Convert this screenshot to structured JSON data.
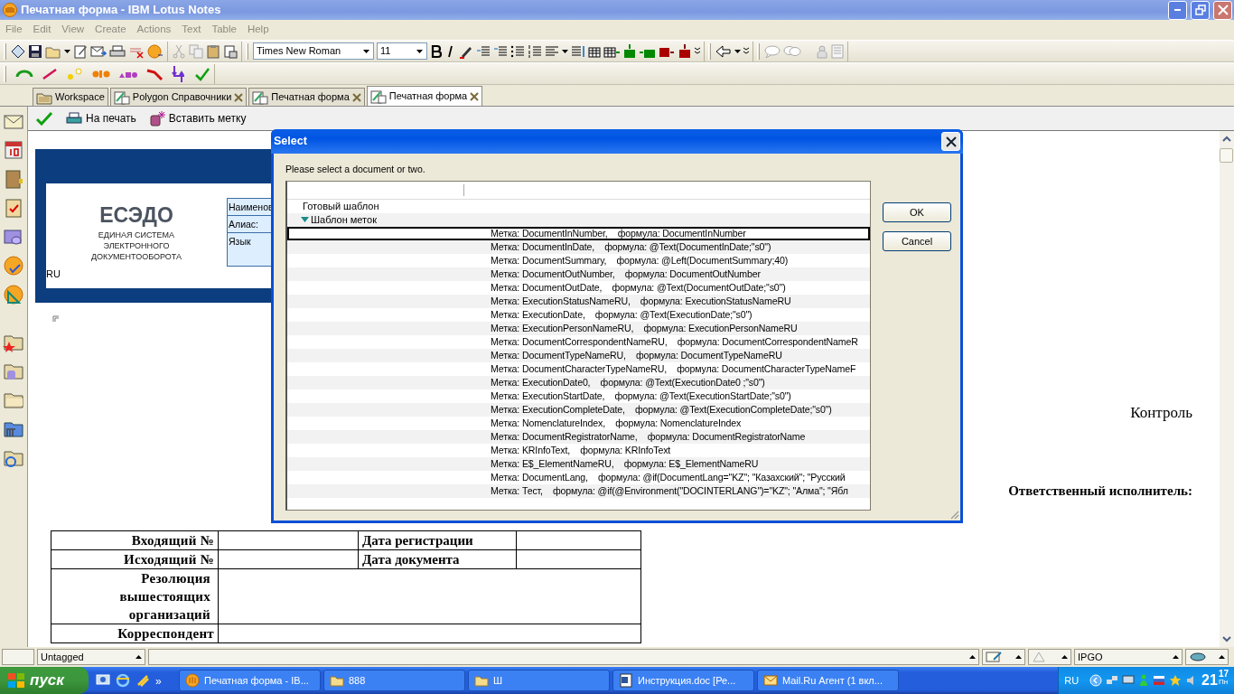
{
  "window": {
    "title": "Печатная форма - IBM Lotus Notes"
  },
  "menu": [
    {
      "label": "File",
      "disabled": true
    },
    {
      "label": "Edit",
      "disabled": true
    },
    {
      "label": "View",
      "disabled": true
    },
    {
      "label": "Create",
      "disabled": true
    },
    {
      "label": "Actions",
      "disabled": true
    },
    {
      "label": "Text",
      "disabled": true
    },
    {
      "label": "Table",
      "disabled": true
    },
    {
      "label": "Help",
      "disabled": true
    }
  ],
  "format_toolbar": {
    "font": "Times New Roman",
    "size": "11"
  },
  "tabs": [
    {
      "label": "Workspace",
      "kind": "workspace",
      "closable": false,
      "selected": false
    },
    {
      "label": "Polygon Справочники",
      "kind": "database",
      "closable": true,
      "selected": false
    },
    {
      "label": "Печатная форма",
      "kind": "database",
      "closable": true,
      "selected": false
    },
    {
      "label": "Печатная форма",
      "kind": "database",
      "closable": true,
      "selected": true
    }
  ],
  "action_bar": [
    {
      "kind": "check"
    },
    {
      "kind": "print",
      "label": "На печать"
    },
    {
      "kind": "tag",
      "label": "Вставить метку"
    }
  ],
  "document": {
    "logo": "ЕСЭДО",
    "logo_subtitle": [
      "ЕДИНАЯ СИСТЕМА",
      "ЭЛЕКТРОННОГО",
      "ДОКУМЕНТООБОРОТА"
    ],
    "language_code": "RU",
    "info_labels": [
      "Наименов",
      "Алиас:",
      "Язык"
    ],
    "right_labels": [
      {
        "label": "Контроль",
        "bold": false
      },
      {
        "label": "Ответственный исполнитель:",
        "bold": true
      }
    ],
    "table": {
      "rows": [
        {
          "label": "Входящий №",
          "field_label": "Дата регистрации"
        },
        {
          "label": "Исходящий №",
          "field_label": "Дата документа"
        },
        {
          "label": "Резолюция вышестоящих организаций"
        },
        {
          "label": "Корреспондент"
        }
      ]
    }
  },
  "dialog": {
    "title": "Select",
    "prompt": "Please select a document or two.",
    "categories": [
      {
        "label": "Готовый шаблон"
      },
      {
        "label": "Шаблон меток",
        "expanded": true,
        "children": [
          {
            "label": "Метка: DocumentInNumber,    формула: DocumentInNumber",
            "focused": true
          },
          {
            "label": "Метка: DocumentInDate,    формула: @Text(DocumentInDate;\"s0\")",
            "focused": false
          },
          {
            "label": "Метка: DocumentSummary,    формула: @Left(DocumentSummary;40)",
            "focused": false
          },
          {
            "label": "Метка: DocumentOutNumber,    формула: DocumentOutNumber",
            "focused": false
          },
          {
            "label": "Метка: DocumentOutDate,    формула: @Text(DocumentOutDate;\"s0\")",
            "focused": false
          },
          {
            "label": "Метка: ExecutionStatusNameRU,    формула: ExecutionStatusNameRU",
            "focused": false
          },
          {
            "label": "Метка: ExecutionDate,    формула: @Text(ExecutionDate;\"s0\")",
            "focused": false
          },
          {
            "label": "Метка: ExecutionPersonNameRU,    формула: ExecutionPersonNameRU",
            "focused": false
          },
          {
            "label": "Метка: DocumentCorrespondentNameRU,    формула: DocumentCorrespondentNameR",
            "focused": false
          },
          {
            "label": "Метка: DocumentTypeNameRU,    формула: DocumentTypeNameRU",
            "focused": false
          },
          {
            "label": "Метка: DocumentCharacterTypeNameRU,    формула: DocumentCharacterTypeNameF",
            "focused": false
          },
          {
            "label": "Метка: ExecutionDate0,    формула: @Text(ExecutionDate0 ;\"s0\")",
            "focused": false
          },
          {
            "label": "Метка: ExecutionStartDate,    формула: @Text(ExecutionStartDate;\"s0\")",
            "focused": false
          },
          {
            "label": "Метка: ExecutionCompleteDate,    формула: @Text(ExecutionCompleteDate;\"s0\")",
            "focused": false
          },
          {
            "label": "Метка: NomenclatureIndex,    формула: NomenclatureIndex",
            "focused": false
          },
          {
            "label": "Метка: DocumentRegistratorName,    формула: DocumentRegistratorName",
            "focused": false
          },
          {
            "label": "Метка: KRInfoText,    формула: KRInfoText",
            "focused": false
          },
          {
            "label": "Метка: E$_ElementNameRU,    формула: E$_ElementNameRU",
            "focused": false
          },
          {
            "label": "Метка: DocumentLang,    формула: @if(DocumentLang=\"KZ\"; \"Казахский\"; \"Русский",
            "focused": false
          },
          {
            "label": "Метка: Тест,    формула: @if(@Environment(\"DOCINTERLANG\")=\"KZ\"; \"Алма\"; \"Ябл",
            "focused": false
          }
        ]
      }
    ],
    "buttons": [
      "OK",
      "Cancel"
    ]
  },
  "status_bar": {
    "tag": "Untagged",
    "location": "IPGO"
  },
  "taskbar": {
    "start": "пуск",
    "more": "»",
    "tasks": [
      {
        "label": "Печатная форма - IB...",
        "kind": "notes"
      },
      {
        "label": "888",
        "kind": "folder"
      },
      {
        "label": "Ш",
        "kind": "folder"
      },
      {
        "label": "Инструкция.doc [Ре...",
        "kind": "document"
      },
      {
        "label": "Mail.Ru Агент (1 вкл...",
        "kind": "mail"
      }
    ],
    "language": "RU",
    "clock": {
      "hours": "21",
      "minutes": "17",
      "day": "Пн"
    }
  }
}
